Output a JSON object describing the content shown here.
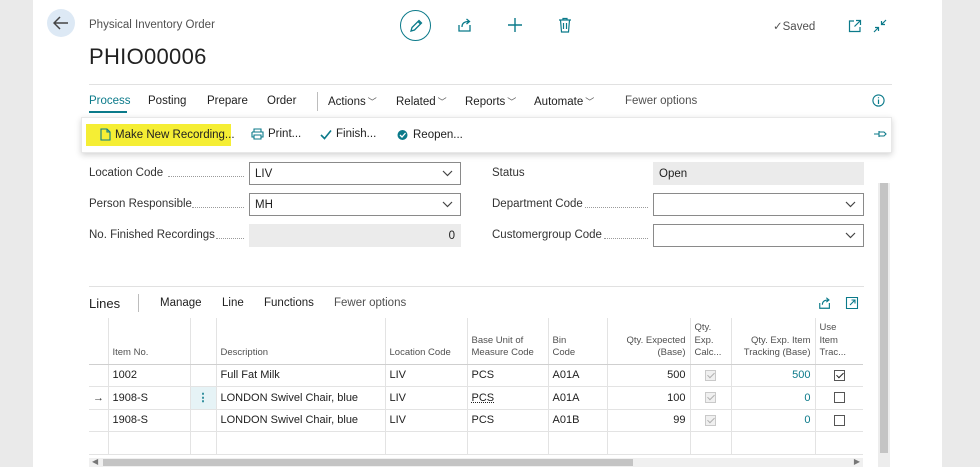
{
  "header": {
    "page_caption": "Physical Inventory Order",
    "document_no": "PHIO00006",
    "status_saved": "Saved"
  },
  "menu": {
    "items": [
      "Process",
      "Posting",
      "Prepare",
      "Order",
      "Actions",
      "Related",
      "Reports",
      "Automate",
      "Fewer options"
    ]
  },
  "actions": {
    "make_new_recording": "Make New Recording...",
    "print": "Print...",
    "finish": "Finish...",
    "reopen": "Reopen..."
  },
  "fields": {
    "location_code": {
      "label": "Location Code",
      "value": "LIV"
    },
    "person_responsible": {
      "label": "Person Responsible",
      "value": "MH"
    },
    "no_finished_recordings": {
      "label": "No. Finished Recordings",
      "value": "0"
    },
    "status": {
      "label": "Status",
      "value": "Open"
    },
    "department_code": {
      "label": "Department Code",
      "value": ""
    },
    "customergroup_code": {
      "label": "Customergroup Code",
      "value": ""
    }
  },
  "lines": {
    "title": "Lines",
    "menu": [
      "Manage",
      "Line",
      "Functions",
      "Fewer options"
    ],
    "columns": {
      "item_no": "Item No.",
      "description": "Description",
      "location_code": "Location Code",
      "base_uom_1": "Base Unit of",
      "base_uom_2": "Measure Code",
      "bin_1": "Bin",
      "bin_2": "Code",
      "qty_exp_1": "Qty. Expected",
      "qty_exp_2": "(Base)",
      "qty_calc_1": "Qty.",
      "qty_calc_2": "Exp.",
      "qty_calc_3": "Calc...",
      "qty_track_1": "Qty. Exp. Item",
      "qty_track_2": "Tracking (Base)",
      "use_track_1": "Use",
      "use_track_2": "Item",
      "use_track_3": "Trac..."
    },
    "rows": [
      {
        "item_no": "1002",
        "description": "Full Fat Milk",
        "location": "LIV",
        "uom": "PCS",
        "bin": "A01A",
        "qty_expected": "500",
        "calc": true,
        "tracking": "500",
        "use_tracking": true
      },
      {
        "item_no": "1908-S",
        "description": "LONDON Swivel Chair, blue",
        "location": "LIV",
        "uom": "PCS",
        "bin": "A01A",
        "qty_expected": "100",
        "calc": true,
        "tracking": "0",
        "use_tracking": false
      },
      {
        "item_no": "1908-S",
        "description": "LONDON Swivel Chair, blue",
        "location": "LIV",
        "uom": "PCS",
        "bin": "A01B",
        "qty_expected": "99",
        "calc": true,
        "tracking": "0",
        "use_tracking": false
      }
    ],
    "current_row_marker": "→",
    "row_actions_glyph": "⋮"
  },
  "colors": {
    "accent": "#0b7a8a",
    "highlight": "#f5ee34"
  },
  "icons": [
    "back-arrow-icon",
    "edit-pencil-icon",
    "share-icon",
    "plus-icon",
    "trash-icon",
    "checkmark-icon",
    "open-new-window-icon",
    "collapse-icon",
    "info-icon",
    "new-document-icon",
    "printer-icon",
    "finish-check-icon",
    "reopen-icon",
    "pin-icon"
  ]
}
